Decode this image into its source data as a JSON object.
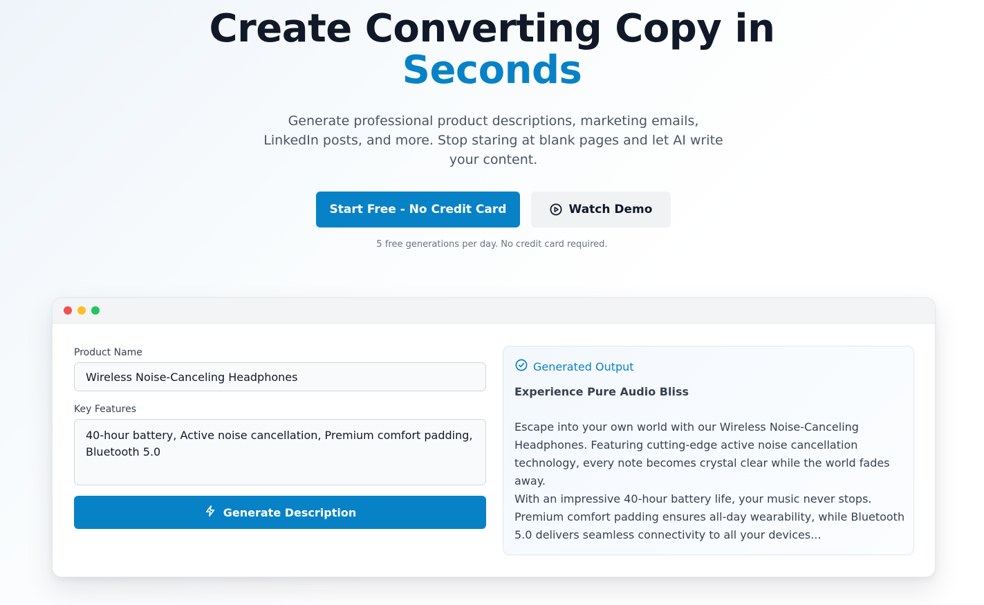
{
  "hero": {
    "headline_main": "Create Converting Copy in",
    "headline_accent": "Seconds",
    "subtitle": "Generate professional product descriptions, marketing emails, LinkedIn posts, and more. Stop staring at blank pages and let AI write your content.",
    "primary_cta": "Start Free - No Credit Card",
    "secondary_cta": "Watch Demo",
    "secondary_cta_icon": "play-circle-icon",
    "note": "5 free generations per day. No credit card required."
  },
  "demo": {
    "window_dots": [
      "#ef5350",
      "#fbbf24",
      "#22c55e"
    ],
    "form": {
      "product_name_label": "Product Name",
      "product_name_value": "Wireless Noise-Canceling Headphones",
      "key_features_label": "Key Features",
      "key_features_value": "40-hour battery, Active noise cancellation, Premium comfort padding, Bluetooth 5.0",
      "generate_button": "Generate Description",
      "generate_icon": "lightning-icon"
    },
    "output": {
      "header": "Generated Output",
      "header_icon": "check-circle-icon",
      "title": "Experience Pure Audio Bliss",
      "paragraph_1": "Escape into your own world with our Wireless Noise-Canceling Headphones. Featuring cutting-edge active noise cancellation technology, every note becomes crystal clear while the world fades away.",
      "paragraph_2": "With an impressive 40-hour battery life, your music never stops. Premium comfort padding ensures all-day wearability, while Bluetooth 5.0 delivers seamless connectivity to all your devices..."
    }
  },
  "colors": {
    "accent": "#0882c6",
    "heading": "#111827",
    "body_text": "#4b5563"
  }
}
